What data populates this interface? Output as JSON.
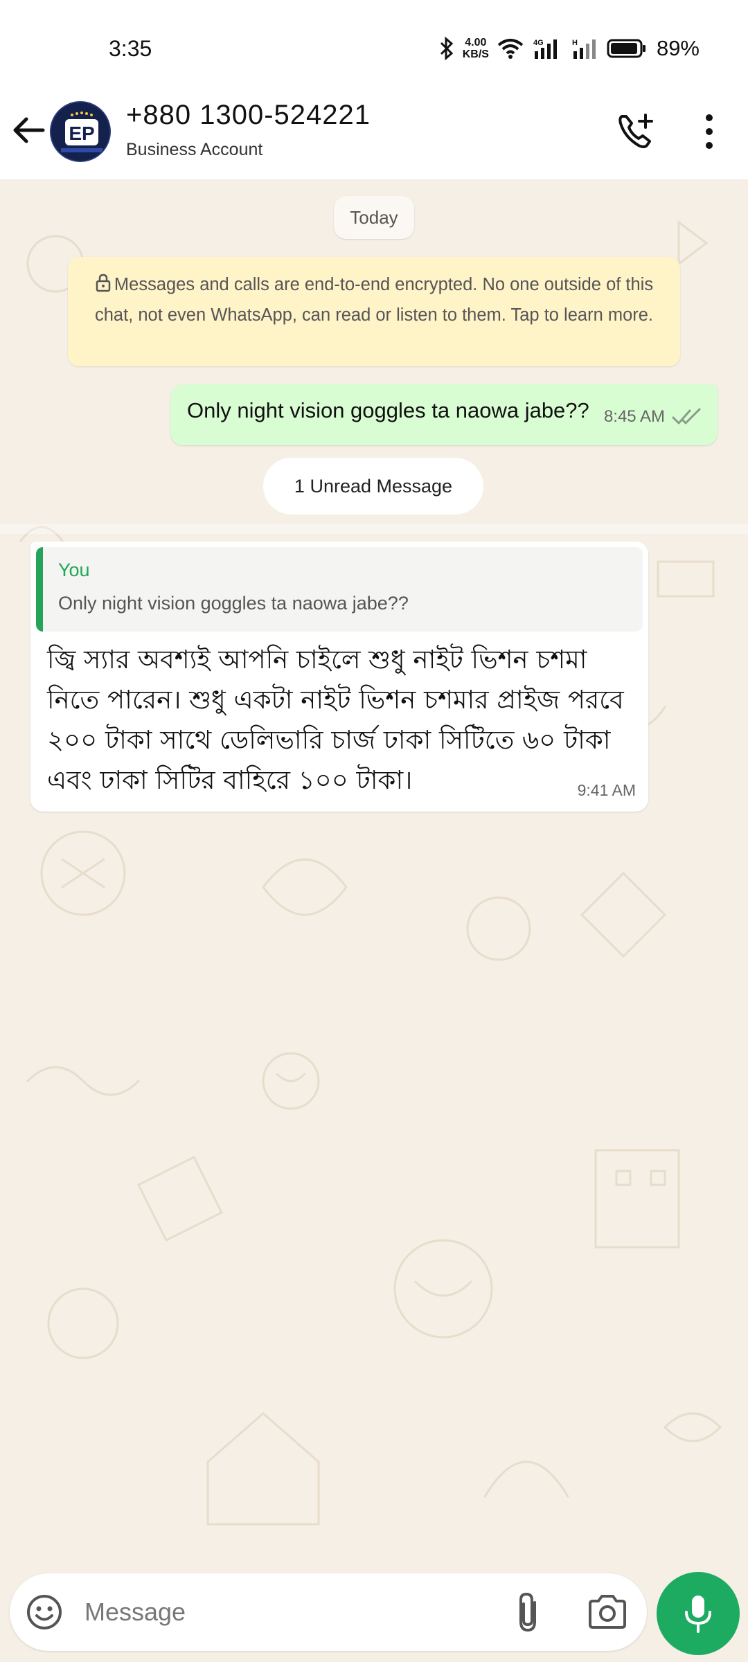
{
  "status_bar": {
    "time": "3:35",
    "net_speed_value": "4.00",
    "net_speed_unit": "KB/S",
    "battery_percent": "89%"
  },
  "header": {
    "contact_name": "+880 1300-524221",
    "subtitle": "Business Account",
    "avatar_text": "EP"
  },
  "chat": {
    "date_chip": "Today",
    "encryption_notice": "Messages and calls are end-to-end encrypted. No one outside of this chat, not even WhatsApp, can read or listen to them. Tap to learn more.",
    "unread_label": "1 Unread Message",
    "messages": [
      {
        "direction": "outgoing",
        "text": "Only night vision goggles ta naowa jabe??",
        "time": "8:45 AM"
      },
      {
        "direction": "incoming",
        "quote_author": "You",
        "quote_text": "Only night vision goggles ta naowa jabe??",
        "text": "জ্বি স্যার অবশ্যই আপনি চাইলে শুধু নাইট ভিশন চশমা নিতে পারেন।  শুধু একটা নাইট ভিশন চশমার প্রাইজ পরবে ২০০ টাকা সাথে ডেলিভারি চার্জ ঢাকা সিটিতে ৬০ টাকা এবং ঢাকা সিটির বাহিরে ১০০ টাকা।",
        "time": "9:41 AM"
      }
    ]
  },
  "composer": {
    "placeholder": "Message"
  },
  "colors": {
    "accent": "#1DAA61",
    "outgoing_bubble": "#D9FDD3",
    "notice_bg": "#FFF3C8",
    "chat_bg": "#F5EFE6"
  }
}
